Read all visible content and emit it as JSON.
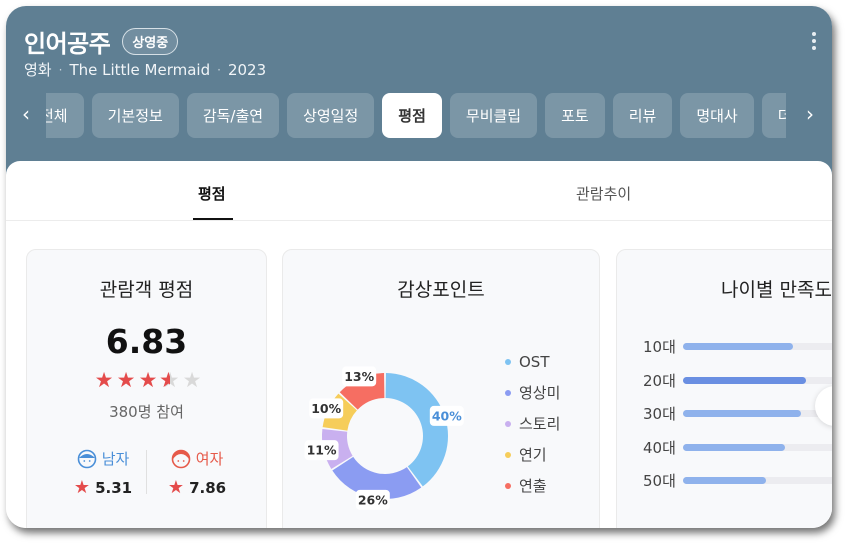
{
  "header": {
    "title": "인어공주",
    "badge": "상영중",
    "category": "영화",
    "original_title": "The Little Mermaid",
    "year": "2023",
    "separator": "·"
  },
  "tabs": [
    "전체",
    "기본정보",
    "감독/출연",
    "상영일정",
    "평점",
    "무비클립",
    "포토",
    "리뷰",
    "명대사",
    "더보기"
  ],
  "active_tab": "평점",
  "subtabs": {
    "rating": "평점",
    "trend": "관람추이"
  },
  "rating_card": {
    "title": "관람객 평점",
    "score": "6.83",
    "stars_value": 3.5,
    "stars_max": 5,
    "participants": "380명 참여",
    "male": {
      "label": "남자",
      "score": "5.31"
    },
    "female": {
      "label": "여자",
      "score": "7.86"
    }
  },
  "points_card": {
    "title": "감상포인트",
    "legend": [
      "OST",
      "영상미",
      "스토리",
      "연기",
      "연출"
    ]
  },
  "age_card": {
    "title": "나이별 만족도",
    "ages": [
      "10대",
      "20대",
      "30대",
      "40대",
      "50대"
    ],
    "fractions": [
      0.69,
      0.77,
      0.74,
      0.64,
      0.52
    ]
  },
  "chart_data": {
    "type": "pie",
    "categories": [
      "OST",
      "영상미",
      "스토리",
      "연기",
      "연출"
    ],
    "values": [
      40,
      26,
      11,
      10,
      13
    ],
    "labels": [
      "40%",
      "26%",
      "11%",
      "10%",
      "13%"
    ],
    "colors": [
      "#7ec3f2",
      "#8b9cf2",
      "#c9b0ef",
      "#f6cd5a",
      "#f66e62"
    ],
    "title": "감상포인트"
  },
  "colors": {
    "header_bg": "#5f7f93",
    "male": "#4a8fd8",
    "female": "#e65a4a",
    "star": "#e44b4b",
    "age_bar": "#8fb2ec",
    "age_bar_highlight": "#6a8fe2"
  }
}
